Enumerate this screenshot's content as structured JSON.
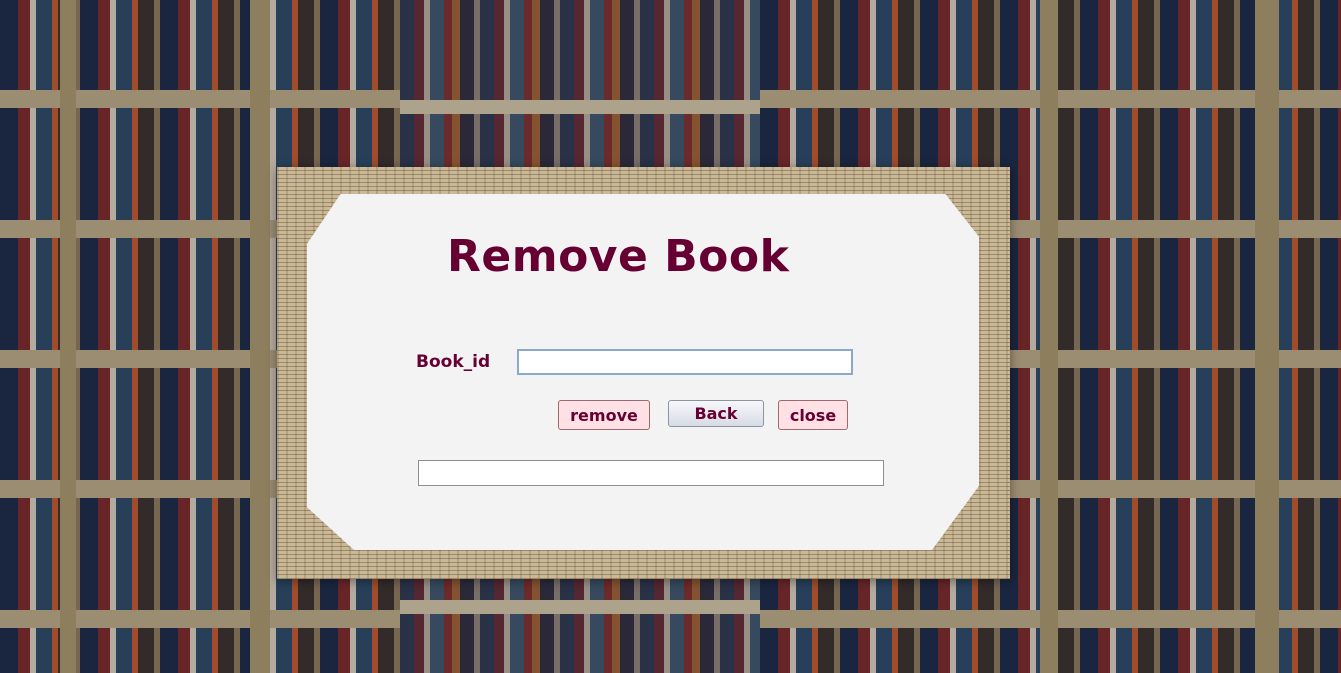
{
  "window": {
    "title": "Remove Book"
  },
  "form": {
    "book_id_label": "Book_id",
    "book_id_value": "",
    "status_value": ""
  },
  "buttons": {
    "remove_label": "remove",
    "back_label": "Back",
    "close_label": "close"
  },
  "colors": {
    "title": "#660033",
    "remove_close_bg": "#ffe0e4",
    "input_border": "#8ba8cf"
  }
}
